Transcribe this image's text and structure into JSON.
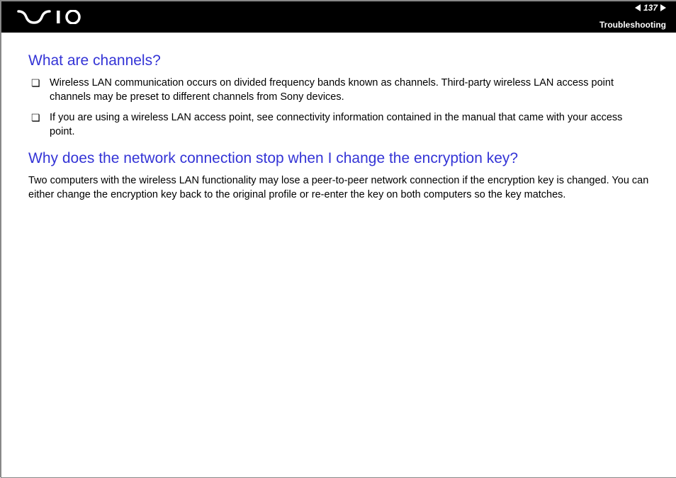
{
  "header": {
    "page_number": "137",
    "section": "Troubleshooting"
  },
  "content": {
    "q1": {
      "title": "What are channels?",
      "bullets": [
        "Wireless LAN communication occurs on divided frequency bands known as channels. Third-party wireless LAN access point channels may be preset to different channels from Sony devices.",
        "If you are using a wireless LAN access point, see connectivity information contained in the manual that came with your access point."
      ]
    },
    "q2": {
      "title": "Why does the network connection stop when I change the encryption key?",
      "body": "Two computers with the wireless LAN functionality may lose a peer-to-peer network connection if the encryption key is changed. You can either change the encryption key back to the original profile or re-enter the key on both computers so the key matches."
    }
  }
}
